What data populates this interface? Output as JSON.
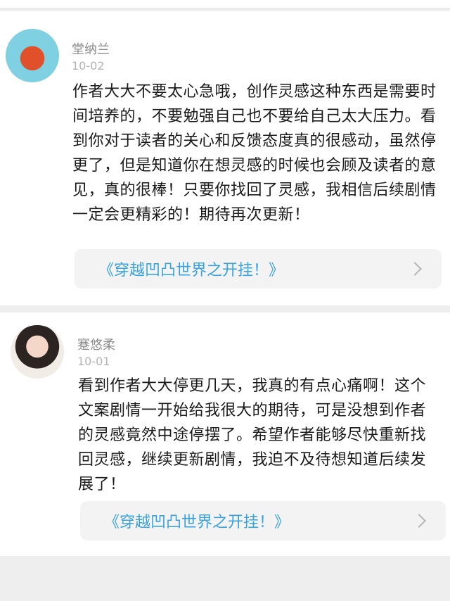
{
  "comments": [
    {
      "username": "堂纳兰",
      "date": "10-02",
      "text": "作者大大不要太心急哦，创作灵感这种东西是需要时间培养的，不要勉强自己也不要给自己太大压力。看到你对于读者的关心和反馈态度真的很感动，虽然停更了，但是知道你在想灵感的时候也会顾及读者的意见，真的很棒！只要你找回了灵感，我相信后续剧情一定会更精彩的！期待再次更新！",
      "book_title": "《穿越凹凸世界之开挂！》",
      "avatar_icon": "bear-costume-avatar-icon"
    },
    {
      "username": "蹇悠柔",
      "date": "10-01",
      "text": "看到作者大大停更几天，我真的有点心痛啊！这个文案剧情一开始给我很大的期待，可是没想到作者的灵感竟然中途停摆了。希望作者能够尽快重新找回灵感，继续更新剧情，我迫不及待想知道后续发展了！",
      "book_title": "《穿越凹凸世界之开挂！》",
      "avatar_icon": "girl-portrait-avatar-icon"
    }
  ],
  "colors": {
    "username": "#8d8d8d",
    "date": "#b3b3b3",
    "link": "#3aa2dd",
    "background": "#eeeeee"
  }
}
